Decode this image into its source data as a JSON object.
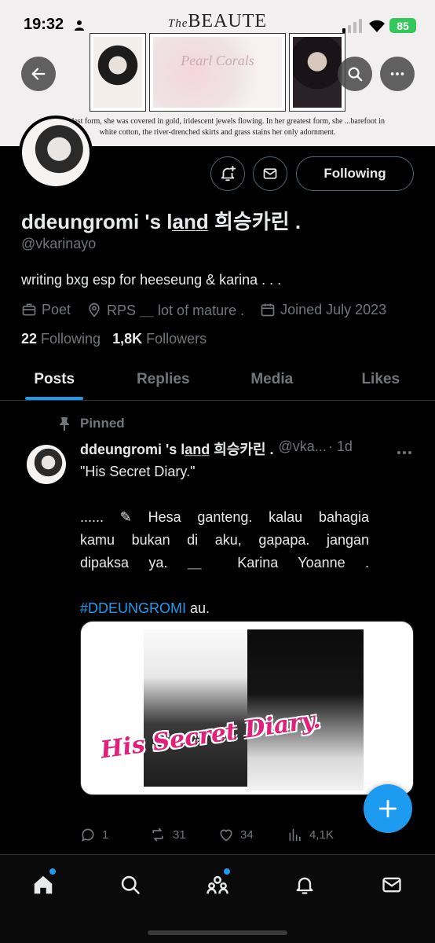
{
  "status_bar": {
    "time": "19:32",
    "battery": "85"
  },
  "banner": {
    "brand_prefix": "The",
    "brand": "BEAUTE",
    "center_text": "Pearl Corals",
    "caption": "...grandest form, she was covered in gold, iridescent jewels flowing. In her greatest form, she ...barefoot in white cotton, the river-drenched skirts and grass stains her only adornment."
  },
  "profile": {
    "display_name": "ddeungromi 's la̲n̲d̲ 희승카린 .",
    "handle": "@vkarinayo",
    "bio": "writing bxg esp for heeseung & karina . . .",
    "category": "Poet",
    "location": "RPS ＿ lot  of  mature .",
    "joined": "Joined July 2023",
    "following_count": "22",
    "following_label": " Following",
    "followers_count": "1,8K",
    "followers_label": " Followers",
    "follow_button": "Following"
  },
  "tabs": [
    {
      "label": "Posts",
      "active": true
    },
    {
      "label": "Replies",
      "active": false
    },
    {
      "label": "Media",
      "active": false
    },
    {
      "label": "Likes",
      "active": false
    }
  ],
  "post": {
    "pinned_label": "Pinned",
    "author_name": "ddeungromi 's la̲n̲d̲ 희승카린 .",
    "author_handle": "@vka...",
    "time": "· 1d",
    "lines": [
      "\"His Secret Diary.\"",
      "",
      "...... ✎ Hesa   ganteng.  kalau  bahagia",
      "kamu  bukan  di  aku, gapapa.  jangan",
      "dipaksa  ya.  ＿ Karina  Yoanne  .",
      ""
    ],
    "hashtag": "#DDEUNGROMI",
    "hashtag_suffix": " au.",
    "image_title": "His Secret Diary.",
    "replies": "1",
    "reposts": "31",
    "likes": "34",
    "views": "4,1K"
  }
}
